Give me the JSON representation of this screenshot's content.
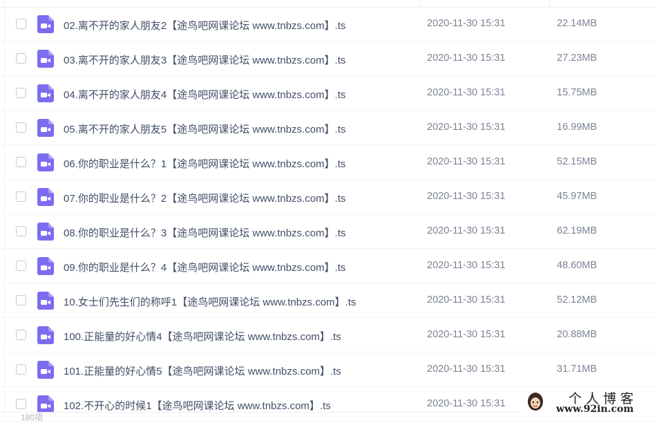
{
  "files": [
    {
      "name": "02.离不开的家人朋友2【途鸟吧网课论坛 www.tnbzs.com】.ts",
      "date": "2020-11-30 15:31",
      "size": "22.14MB"
    },
    {
      "name": "03.离不开的家人朋友3【途鸟吧网课论坛 www.tnbzs.com】.ts",
      "date": "2020-11-30 15:31",
      "size": "27.23MB"
    },
    {
      "name": "04.离不开的家人朋友4【途鸟吧网课论坛 www.tnbzs.com】.ts",
      "date": "2020-11-30 15:31",
      "size": "15.75MB"
    },
    {
      "name": "05.离不开的家人朋友5【途鸟吧网课论坛 www.tnbzs.com】.ts",
      "date": "2020-11-30 15:31",
      "size": "16.99MB"
    },
    {
      "name": "06.你的职业是什么？1【途鸟吧网课论坛 www.tnbzs.com】.ts",
      "date": "2020-11-30 15:31",
      "size": "52.15MB"
    },
    {
      "name": "07.你的职业是什么？2【途鸟吧网课论坛 www.tnbzs.com】.ts",
      "date": "2020-11-30 15:31",
      "size": "45.97MB"
    },
    {
      "name": "08.你的职业是什么？3【途鸟吧网课论坛 www.tnbzs.com】.ts",
      "date": "2020-11-30 15:31",
      "size": "62.19MB"
    },
    {
      "name": "09.你的职业是什么？4【途鸟吧网课论坛 www.tnbzs.com】.ts",
      "date": "2020-11-30 15:31",
      "size": "48.60MB"
    },
    {
      "name": "10.女士们先生们的称呼1【途鸟吧网课论坛 www.tnbzs.com】.ts",
      "date": "2020-11-30 15:31",
      "size": "52.12MB"
    },
    {
      "name": "100.正能量的好心情4【途鸟吧网课论坛 www.tnbzs.com】.ts",
      "date": "2020-11-30 15:31",
      "size": "20.88MB"
    },
    {
      "name": "101.正能量的好心情5【途鸟吧网课论坛 www.tnbzs.com】.ts",
      "date": "2020-11-30 15:31",
      "size": "31.71MB"
    },
    {
      "name": "102.不开心的时候1【途鸟吧网课论坛 www.tnbzs.com】.ts",
      "date": "2020-11-30 15:31",
      "size": ""
    }
  ],
  "footer": {
    "count_label": "180项"
  },
  "watermark": {
    "title": "个人博客",
    "url": "www.92in.com"
  },
  "colors": {
    "file_icon": "#7c6cf0",
    "text": "#424e67",
    "muted": "#7b8394"
  },
  "icons": {
    "file": "video-file-icon",
    "checkbox": "checkbox-icon",
    "avatar": "avatar-icon"
  }
}
